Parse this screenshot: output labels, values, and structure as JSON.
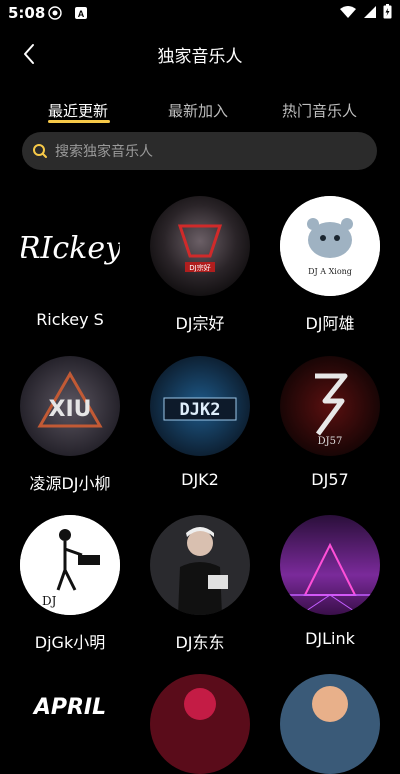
{
  "status": {
    "time": "5:08"
  },
  "header": {
    "title": "独家音乐人"
  },
  "tabs": [
    {
      "label": "最近更新",
      "active": true
    },
    {
      "label": "最新加入",
      "active": false
    },
    {
      "label": "热门音乐人",
      "active": false
    }
  ],
  "search": {
    "placeholder": "搜索独家音乐人"
  },
  "artists": [
    {
      "name": "Rickey S",
      "avatar_text": "RIckey"
    },
    {
      "name": "DJ宗好",
      "avatar_text": "DJ宗好"
    },
    {
      "name": "DJ阿雄",
      "avatar_text": "DJ A Xiong"
    },
    {
      "name": "凌源DJ小柳",
      "avatar_text": "XIU"
    },
    {
      "name": "DJK2",
      "avatar_text": "DJK2"
    },
    {
      "name": "DJ57",
      "avatar_text": "DJ57"
    },
    {
      "name": "DjGk小明",
      "avatar_text": "DJ"
    },
    {
      "name": "DJ东东",
      "avatar_text": ""
    },
    {
      "name": "DJLink",
      "avatar_text": ""
    },
    {
      "name": "",
      "avatar_text": "APRIL"
    },
    {
      "name": "",
      "avatar_text": ""
    },
    {
      "name": "",
      "avatar_text": ""
    }
  ],
  "colors": {
    "accent": "#f7c948",
    "background": "#000000",
    "search_bg": "#2b2b2b"
  }
}
